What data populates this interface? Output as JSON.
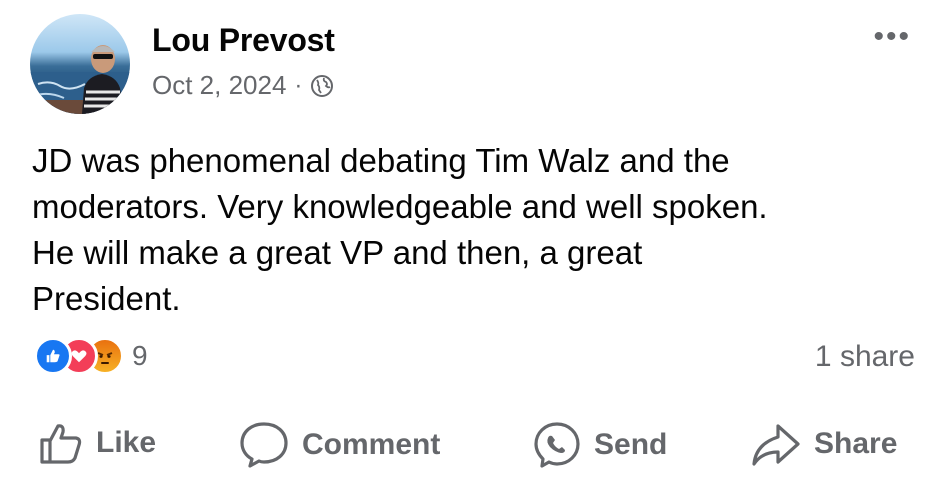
{
  "post": {
    "author": "Lou Prevost",
    "date": "Oct 2, 2024",
    "separator": "·",
    "more_label": "•••",
    "text_lines": [
      "JD was phenomenal debating Tim Walz and the",
      "moderators.  Very knowledgeable and well spoken.",
      "He will make a great VP and then, a great",
      "President."
    ],
    "reaction_count": "9",
    "shares": "1 share",
    "reactions": [
      "like-icon",
      "love-icon",
      "angry-icon"
    ],
    "privacy_icon": "globe-icon"
  },
  "actions": {
    "like": "Like",
    "comment": "Comment",
    "send": "Send",
    "share": "Share"
  },
  "colors": {
    "text": "#050505",
    "secondary": "#65676b",
    "like_blue": "#1877f2",
    "love_red": "#f33e58",
    "angry_orange": "#e9710f"
  }
}
